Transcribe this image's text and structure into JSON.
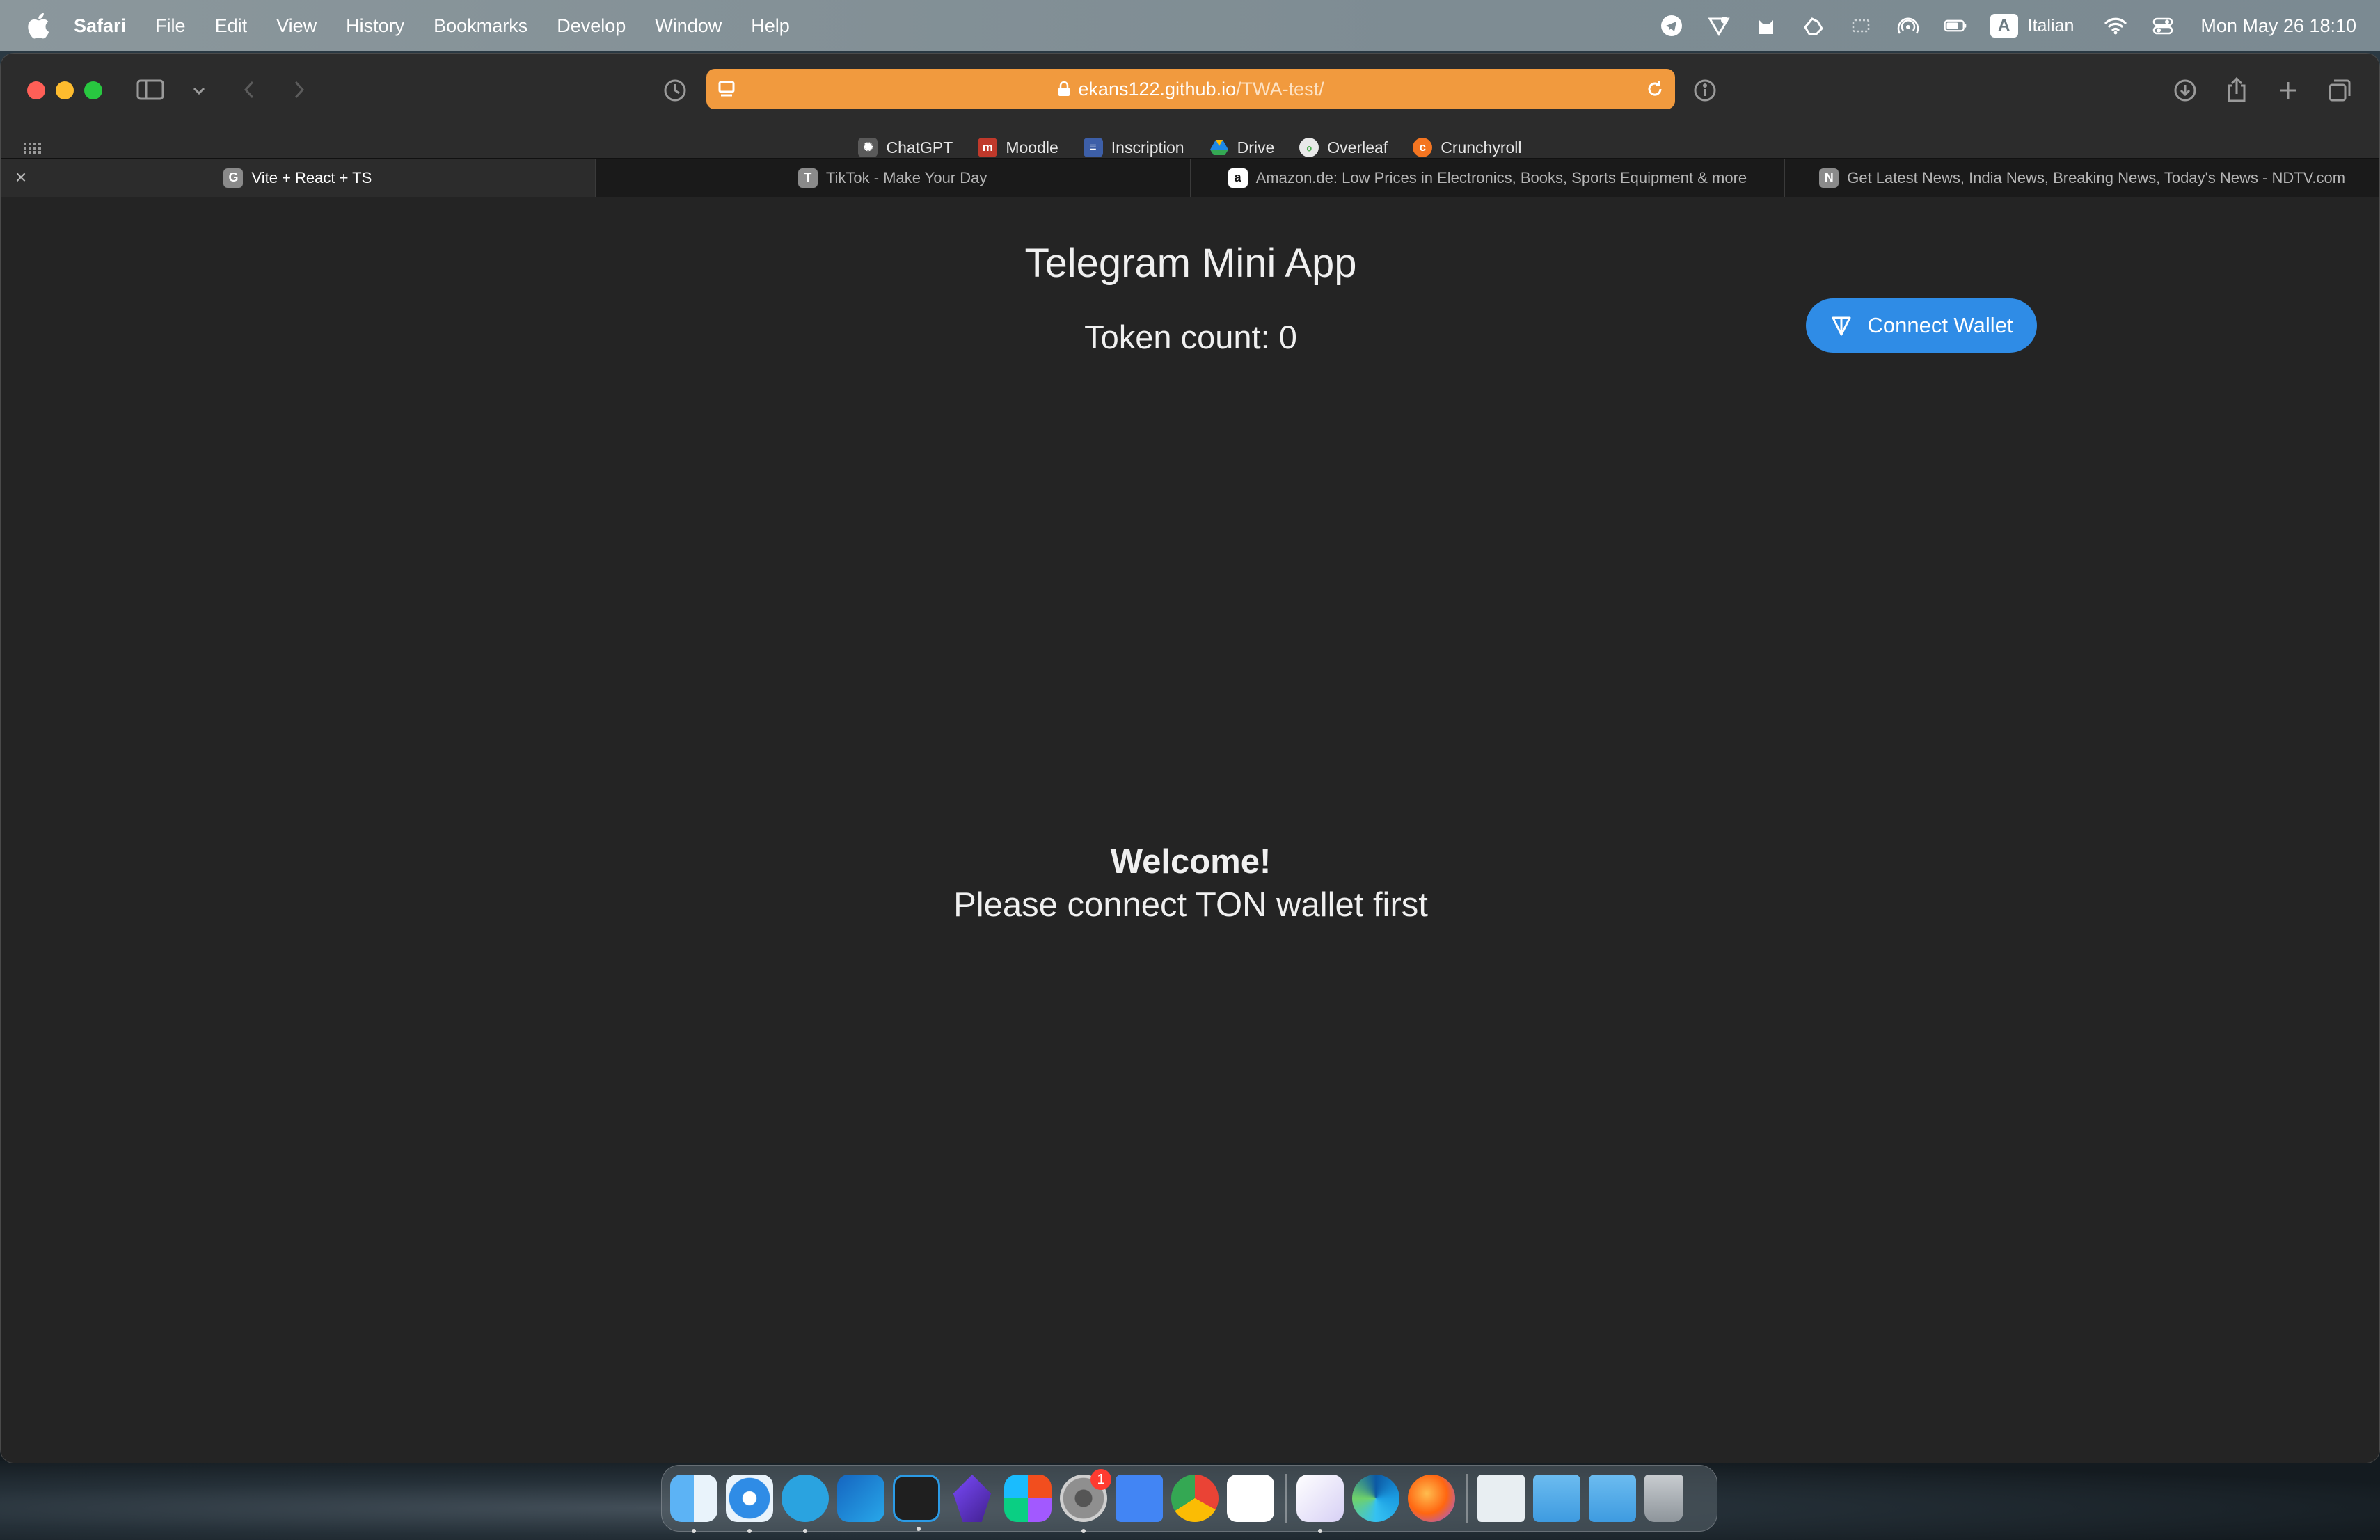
{
  "menubar": {
    "app_name": "Safari",
    "items": [
      "File",
      "Edit",
      "View",
      "History",
      "Bookmarks",
      "Develop",
      "Window",
      "Help"
    ],
    "input_source": "A",
    "language": "Italian",
    "clock": "Mon May 26  18:10"
  },
  "browser": {
    "url_host": "ekans122.github.io",
    "url_path": "/TWA-test/",
    "favorites": [
      {
        "label": "ChatGPT",
        "icon": "chatgpt-icon",
        "color": "#5a5a5a"
      },
      {
        "label": "Moodle",
        "icon": "moodle-icon",
        "color": "#c0392b"
      },
      {
        "label": "Inscription",
        "icon": "inscription-icon",
        "color": "#3d5fa8"
      },
      {
        "label": "Drive",
        "icon": "drive-icon",
        "color": "#1e88e5"
      },
      {
        "label": "Overleaf",
        "icon": "overleaf-icon",
        "color": "#4caf50"
      },
      {
        "label": "Crunchyroll",
        "icon": "crunchyroll-icon",
        "color": "#f47521"
      }
    ],
    "tabs": [
      {
        "label": "Vite + React + TS",
        "icon_letter": "G",
        "active": true
      },
      {
        "label": "TikTok - Make Your Day",
        "icon_letter": "T",
        "active": false
      },
      {
        "label": "Amazon.de: Low Prices in Electronics, Books, Sports Equipment & more",
        "icon_letter": "a",
        "active": false
      },
      {
        "label": "Get Latest News, India News, Breaking News, Today's News - NDTV.com",
        "icon_letter": "N",
        "active": false
      }
    ]
  },
  "page": {
    "title": "Telegram Mini App",
    "token_count": "Token count: 0",
    "connect_button": "Connect Wallet",
    "welcome": "Welcome!",
    "welcome_sub": "Please connect TON wallet first"
  },
  "dock": {
    "apps": [
      "finder-icon",
      "safari-icon",
      "telegram-icon",
      "outlook-icon",
      "vscode-icon",
      "obsidian-icon",
      "figma-icon",
      "system-settings-icon",
      "google-docs-icon",
      "chrome-icon",
      "moodle-app-icon",
      "proton-vpn-icon",
      "edge-icon",
      "firefox-icon",
      "documents-folder-icon",
      "folder-icon",
      "downloads-folder-icon",
      "trash-icon"
    ],
    "settings_badge": "1"
  },
  "colors": {
    "accent_blue": "#2f8ce6",
    "address_bar": "#f19a3e",
    "page_background": "#242424"
  }
}
